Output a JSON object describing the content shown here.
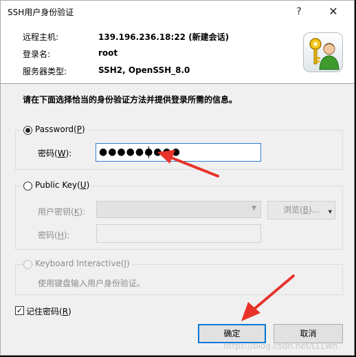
{
  "window": {
    "title": "SSH用户身份验证",
    "help_glyph": "?",
    "close_glyph": "✕"
  },
  "session": {
    "remote_host_label": "远程主机:",
    "remote_host_value": "139.196.236.18:22 (新建会话)",
    "login_label": "登录名:",
    "login_value": "root",
    "server_type_label": "服务器类型:",
    "server_type_value": "SSH2, OpenSSH_8.0"
  },
  "prompt": "请在下面选择恰当的身份验证方法并提供登录所需的信息。",
  "password_group": {
    "radio_label_pre": "Password(",
    "radio_hotkey": "P",
    "radio_label_post": ")",
    "selected": true,
    "field_label_pre": "密码(",
    "field_hotkey": "W",
    "field_label_post": "):",
    "field_value": "●●●●●●●●●"
  },
  "publickey_group": {
    "radio_label_pre": "Public Key(",
    "radio_hotkey": "U",
    "radio_label_post": ")",
    "key_label_pre": "用户密钥(",
    "key_hotkey": "K",
    "key_label_post": "):",
    "browse_pre": "浏览(",
    "browse_hotkey": "B",
    "browse_post": ")...",
    "pass_label_pre": "密码(",
    "pass_hotkey": "H",
    "pass_label_post": "):"
  },
  "keyboard_group": {
    "radio_label_pre": "Keyboard Interactive(",
    "radio_hotkey": "I",
    "radio_label_post": ")",
    "description": "使用键盘输入用户身份验证。"
  },
  "remember": {
    "label_pre": "记住密码(",
    "hotkey": "R",
    "label_post": ")",
    "checked": true,
    "check_glyph": "✓"
  },
  "buttons": {
    "ok": "确定",
    "cancel": "取消"
  },
  "watermark": "https://blog.csdn.net/LLLwh",
  "colors": {
    "accent": "#0078d7",
    "annotation_arrow": "#e8332a"
  },
  "icons": [
    "help-icon",
    "close-icon",
    "key-user-icon",
    "dropdown-arrow-icon",
    "check-icon"
  ]
}
